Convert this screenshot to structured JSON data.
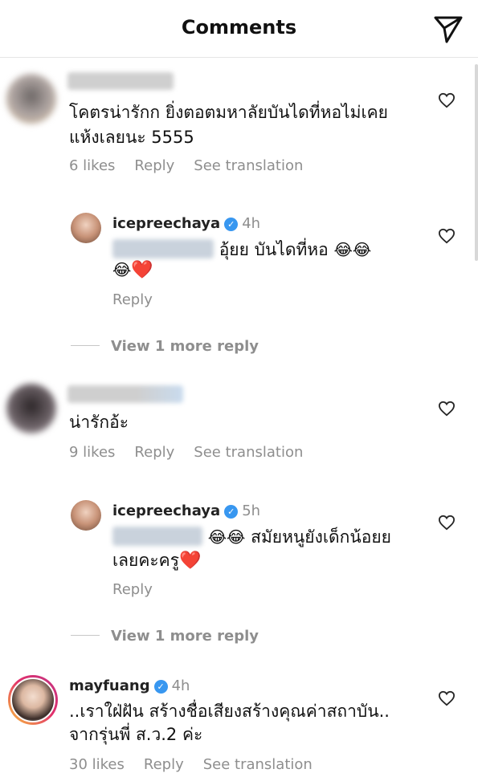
{
  "header": {
    "title": "Comments",
    "send_icon": "paper-plane-icon"
  },
  "comments": [
    {
      "text": [
        "โคตรน่ารักก ยิ่งตอตมหาลัยบันไดที่หอไม่เคย",
        "แห้งเลยนะ 5555"
      ],
      "likes": "6 likes",
      "reply": "Reply",
      "see_translation": "See translation"
    },
    {
      "username": "icepreechaya",
      "time": "4h",
      "text_line1": "อุ้ยย บันไดที่หอ",
      "emoji_line1": "😂😂",
      "emoji_line2": "😂",
      "heart": "❤️",
      "reply": "Reply"
    },
    {
      "text": [
        "น่ารักอ้ะ"
      ],
      "likes": "9 likes",
      "reply": "Reply",
      "see_translation": "See translation"
    },
    {
      "username": "icepreechaya",
      "time": "5h",
      "emoji_line1": "😂😂",
      "text_line1": "สมัยหนูยังเด็กน้อยย",
      "text_line2": "เลยคะครู",
      "heart": "❤️",
      "reply": "Reply"
    },
    {
      "username": "mayfuang",
      "time": "4h",
      "text": [
        "..เราใฝ่ฝัน สร้างชื่อเสียงสร้างคุณค่าสถาบัน..",
        "จากรุ่นพี่ ส.ว.2 ค่ะ"
      ],
      "likes": "30 likes",
      "reply": "Reply",
      "see_translation": "See translation"
    }
  ],
  "view_more_replies": [
    "View 1 more reply",
    "View 1 more reply"
  ],
  "colors": {
    "secondary_text": "#8e8e8e",
    "verified": "#3897f0",
    "heart_red": "#e0245e"
  }
}
